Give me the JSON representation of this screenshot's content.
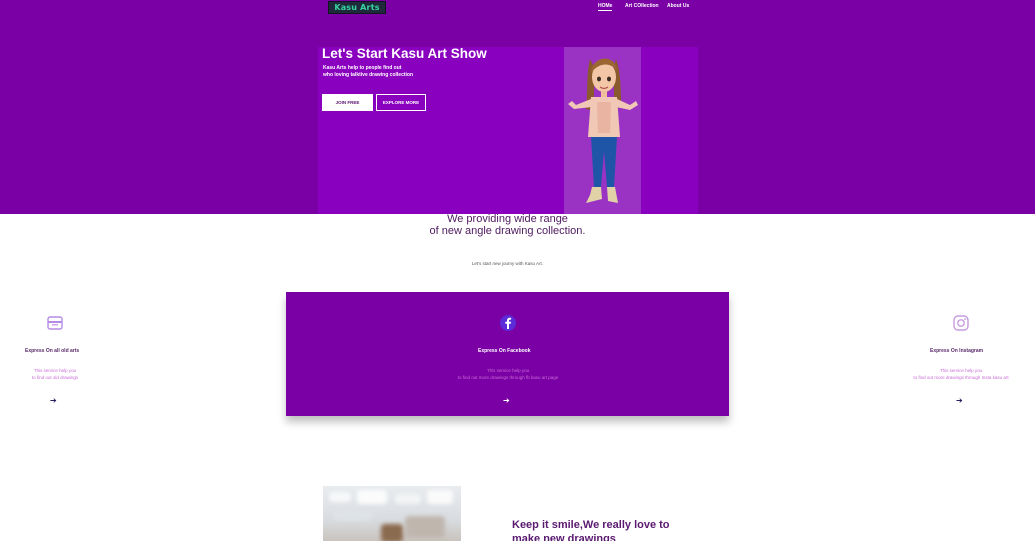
{
  "header": {
    "logo_text": "Kasu Arts",
    "nav": [
      {
        "label": "HOMe"
      },
      {
        "label": "Art COllection"
      },
      {
        "label": "About Us"
      }
    ]
  },
  "hero": {
    "title": "Let's Start Kasu Art Show",
    "subtitle_lines": [
      "Kasu Arts help to people find out",
      "who loving talktive drawing collection"
    ],
    "join_button": "JOIN FREE",
    "explore_button": "EXPLORE MORE"
  },
  "section": {
    "title_lines": [
      "We providing wide range",
      "of new angle drawing collection."
    ],
    "caption": "Let's start new journy with Kasu Art."
  },
  "services": [
    {
      "title": "Express On all old arts",
      "desc_lines": [
        "This service help you",
        "to find out old drawings"
      ],
      "icon": "archive-box-icon",
      "arrow": "➔"
    },
    {
      "title": "Express On Facebook",
      "desc_lines": [
        "This service help you",
        "to find out more drawings through fb kasu art page"
      ],
      "icon": "facebook-icon",
      "arrow": "➔"
    },
    {
      "title": "Express On Instagram",
      "desc_lines": [
        "This service help you",
        "to find out more drawings through Insta kasu art"
      ],
      "icon": "instagram-icon",
      "arrow": "➔"
    }
  ],
  "bottom": {
    "title_lines": [
      "Keep it smile,We really love to",
      "make new drawings"
    ]
  },
  "colors": {
    "brand_purple": "#7a00a5",
    "panel_purple": "#8a00bf",
    "heading_text": "#4e1a5e",
    "service_text": "#c86bd6"
  }
}
